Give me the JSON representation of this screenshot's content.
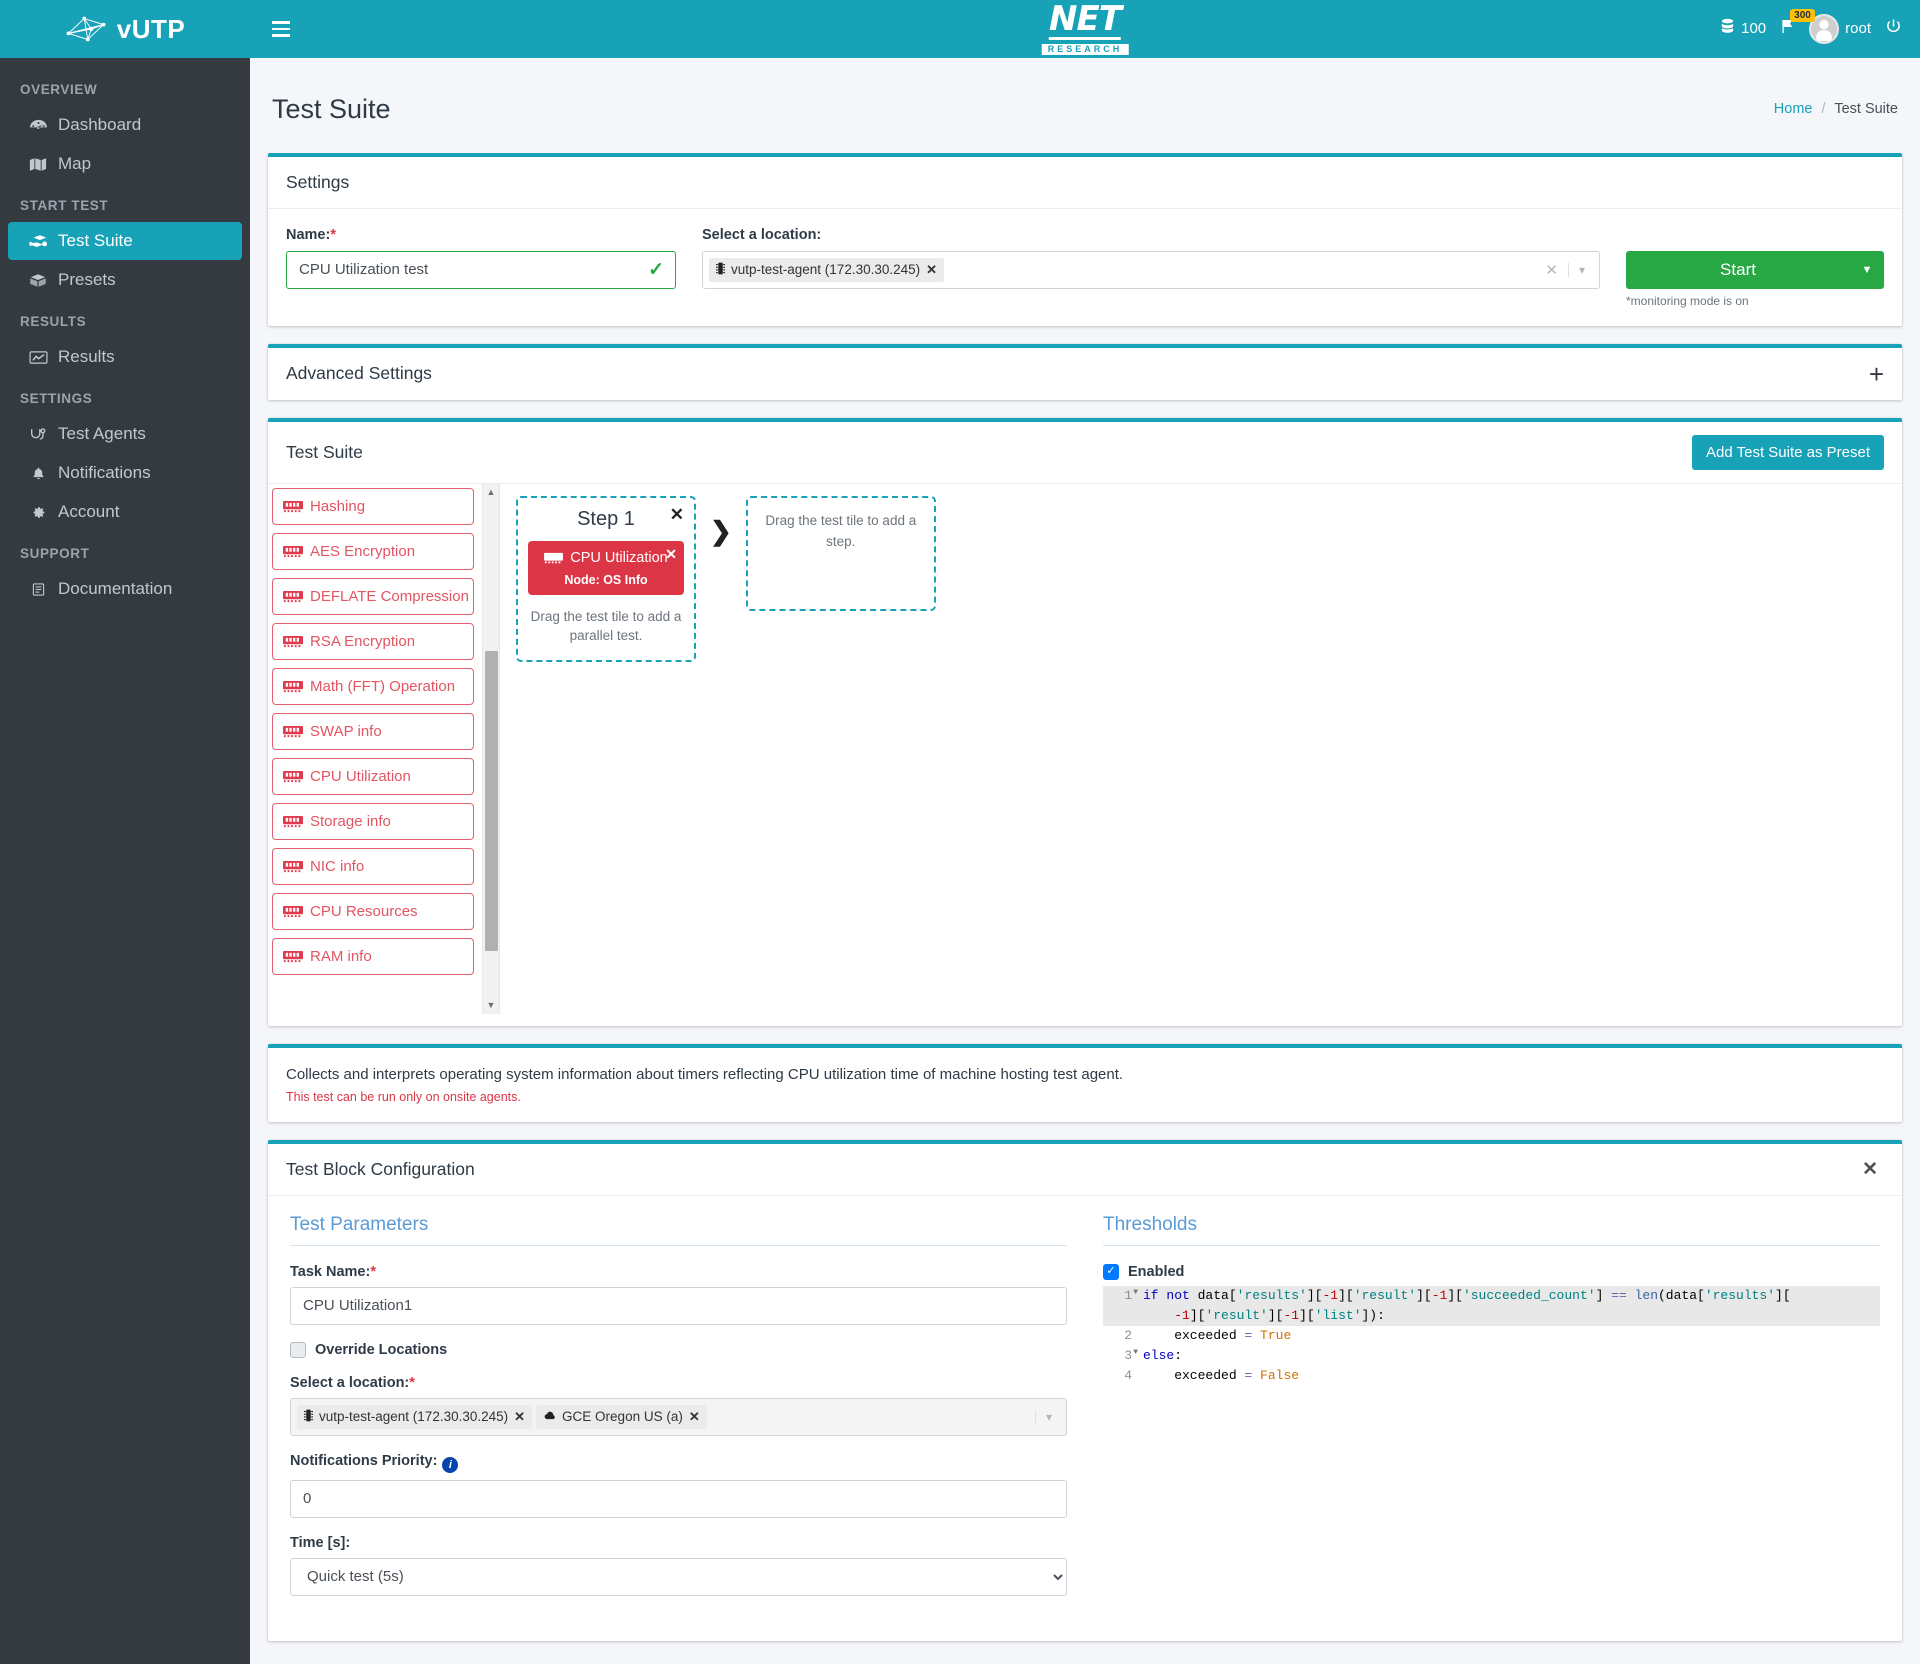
{
  "brand": {
    "name": "vUTP",
    "logo_icon": "network-logo-icon"
  },
  "sidebar": {
    "sections": [
      {
        "header": "OVERVIEW",
        "items": [
          {
            "label": "Dashboard",
            "icon": "dashboard-icon",
            "active": false
          },
          {
            "label": "Map",
            "icon": "map-icon",
            "active": false
          }
        ]
      },
      {
        "header": "START TEST",
        "items": [
          {
            "label": "Test Suite",
            "icon": "test-suite-icon",
            "active": true
          },
          {
            "label": "Presets",
            "icon": "box-icon",
            "active": false
          }
        ]
      },
      {
        "header": "RESULTS",
        "items": [
          {
            "label": "Results",
            "icon": "chart-line-icon",
            "active": false
          }
        ]
      },
      {
        "header": "SETTINGS",
        "items": [
          {
            "label": "Test Agents",
            "icon": "agents-icon",
            "active": false
          },
          {
            "label": "Notifications",
            "icon": "bell-icon",
            "active": false
          },
          {
            "label": "Account",
            "icon": "gear-icon",
            "active": false
          }
        ]
      },
      {
        "header": "SUPPORT",
        "items": [
          {
            "label": "Documentation",
            "icon": "document-icon",
            "active": false
          }
        ]
      }
    ]
  },
  "topbar": {
    "hamburger_icon": "hamburger-icon",
    "logo_main": "NET",
    "logo_sub": "RESEARCH",
    "credits_icon": "database-icon",
    "credits": "100",
    "flag_icon": "flag-icon",
    "flag_badge": "300",
    "avatar_icon": "user-avatar-icon",
    "username": "root",
    "power_icon": "power-icon"
  },
  "page": {
    "title": "Test Suite",
    "breadcrumb_home": "Home",
    "breadcrumb_sep": "/",
    "breadcrumb_current": "Test Suite"
  },
  "settings_card": {
    "title": "Settings",
    "name_label": "Name:",
    "name_value": "CPU Utilization test",
    "name_placeholder": "Name",
    "valid_icon": "check-icon",
    "location_label": "Select a location:",
    "location_chips": [
      {
        "icon": "server-icon",
        "label": "vutp-test-agent (172.30.30.245)",
        "remove": "✕"
      }
    ],
    "clear_icon": "✕",
    "caret_icon": "⌄",
    "start_label": "Start",
    "start_caret": "▼",
    "monitoring_note": "*monitoring mode is on"
  },
  "advanced_card": {
    "title": "Advanced Settings",
    "expand_icon": "+"
  },
  "suite_card": {
    "title": "Test Suite",
    "preset_button": "Add Test Suite as Preset",
    "tiles": [
      {
        "label": "Hashing",
        "icon": "ram-icon"
      },
      {
        "label": "AES Encryption",
        "icon": "ram-icon"
      },
      {
        "label": "DEFLATE Compression",
        "icon": "ram-icon"
      },
      {
        "label": "RSA Encryption",
        "icon": "ram-icon"
      },
      {
        "label": "Math (FFT) Operation",
        "icon": "ram-icon"
      },
      {
        "label": "SWAP info",
        "icon": "ram-icon"
      },
      {
        "label": "CPU Utilization",
        "icon": "ram-icon"
      },
      {
        "label": "Storage info",
        "icon": "ram-icon"
      },
      {
        "label": "NIC info",
        "icon": "ram-icon"
      },
      {
        "label": "CPU Resources",
        "icon": "ram-icon"
      },
      {
        "label": "RAM info",
        "icon": "ram-icon"
      }
    ],
    "scroll_up_icon": "▲",
    "scroll_down_icon": "▼",
    "step": {
      "title": "Step 1",
      "close_icon": "✕",
      "block_title": "CPU Utilization",
      "block_node": "Node: OS Info",
      "block_close_icon": "✕",
      "parallel_hint": "Drag the test tile to add a parallel test."
    },
    "arrow_icon": "❯",
    "next_step_hint": "Drag the test tile to add a step."
  },
  "description_card": {
    "text": "Collects and interprets operating system information about timers reflecting CPU utilization time of machine hosting test agent.",
    "warning": "This test can be run only on onsite agents."
  },
  "config_card": {
    "title": "Test Block Configuration",
    "close_icon": "✕",
    "params": {
      "section_title": "Test Parameters",
      "task_name_label": "Task Name:",
      "task_name_value": "CPU Utilization1",
      "task_name_placeholder": "Task Name",
      "override_label": "Override Locations",
      "location_label": "Select a location:",
      "location_chips": [
        {
          "icon": "server-icon",
          "label": "vutp-test-agent (172.30.30.245)",
          "remove": "✕"
        },
        {
          "icon": "cloud-icon",
          "label": "GCE Oregon US (a)",
          "remove": "✕"
        }
      ],
      "caret_icon": "⌄",
      "priority_label": "Notifications Priority:",
      "priority_info_icon": "info-icon",
      "priority_value": "0",
      "priority_placeholder": "0",
      "time_label": "Time [s]:",
      "time_value": "Quick test (5s)",
      "time_options": [
        "Quick test (5s)"
      ]
    },
    "thresholds": {
      "section_title": "Thresholds",
      "enabled_label": "Enabled",
      "enabled_checked": true,
      "code_lines": [
        {
          "num": "1",
          "fold": true,
          "highlight": true,
          "wrapped": true
        },
        {
          "num": "2",
          "fold": false,
          "highlight": false
        },
        {
          "num": "3",
          "fold": true,
          "highlight": false
        },
        {
          "num": "4",
          "fold": false,
          "highlight": false
        }
      ],
      "code_text_1a": "if not data['results'][-1]['result'][-1]['succeeded_count'] == len(data['results'][",
      "code_text_1b": "-1]['result'][-1]['list']):",
      "code_text_2": "    exceeded = True",
      "code_text_3": "else:",
      "code_text_4": "    exceeded = False"
    }
  },
  "colors": {
    "brand_teal": "#17a2b8",
    "sidebar_dark": "#343a40",
    "start_green": "#28a745",
    "test_red": "#dc3545",
    "badge_amber": "#ffc107",
    "section_blue": "#5b9bd5"
  }
}
